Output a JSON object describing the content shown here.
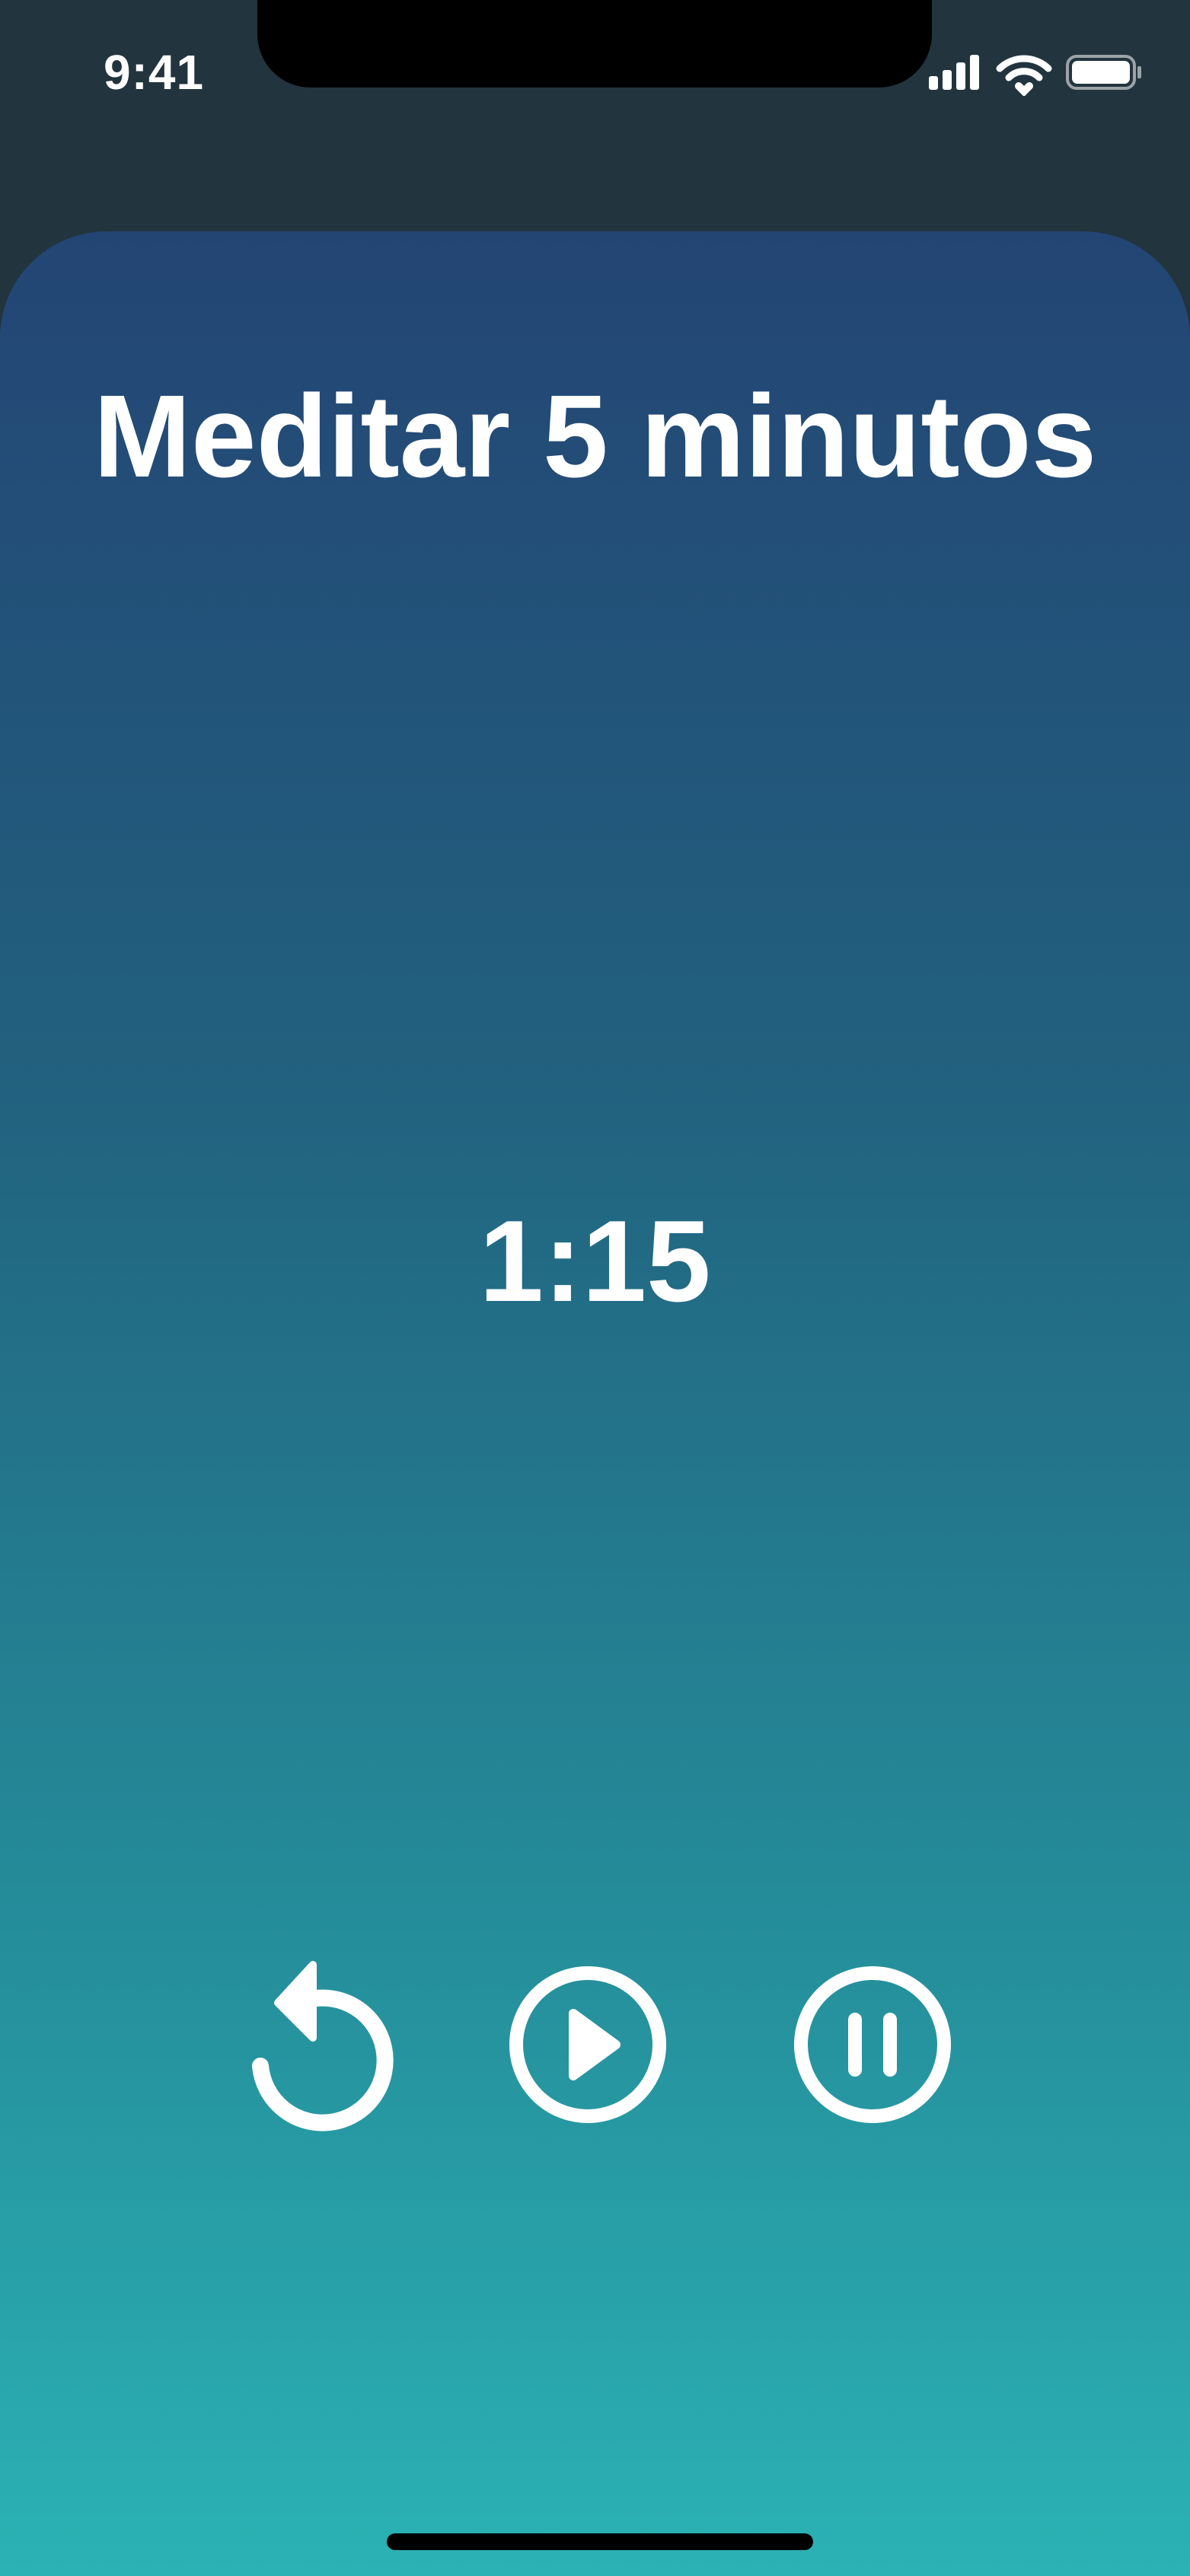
{
  "status_bar": {
    "time": "9:41",
    "icons": [
      "signal-icon",
      "wifi-icon",
      "battery-icon"
    ]
  },
  "screen": {
    "title": "Meditar 5 minutos",
    "timer": "1:15"
  },
  "controls": {
    "icons": [
      "restart-icon",
      "play-icon",
      "pause-icon"
    ]
  },
  "colors": {
    "background": "#22343d",
    "gradient_top": "#234574",
    "gradient_bottom": "#2bb2b4",
    "foreground": "#ffffff"
  }
}
